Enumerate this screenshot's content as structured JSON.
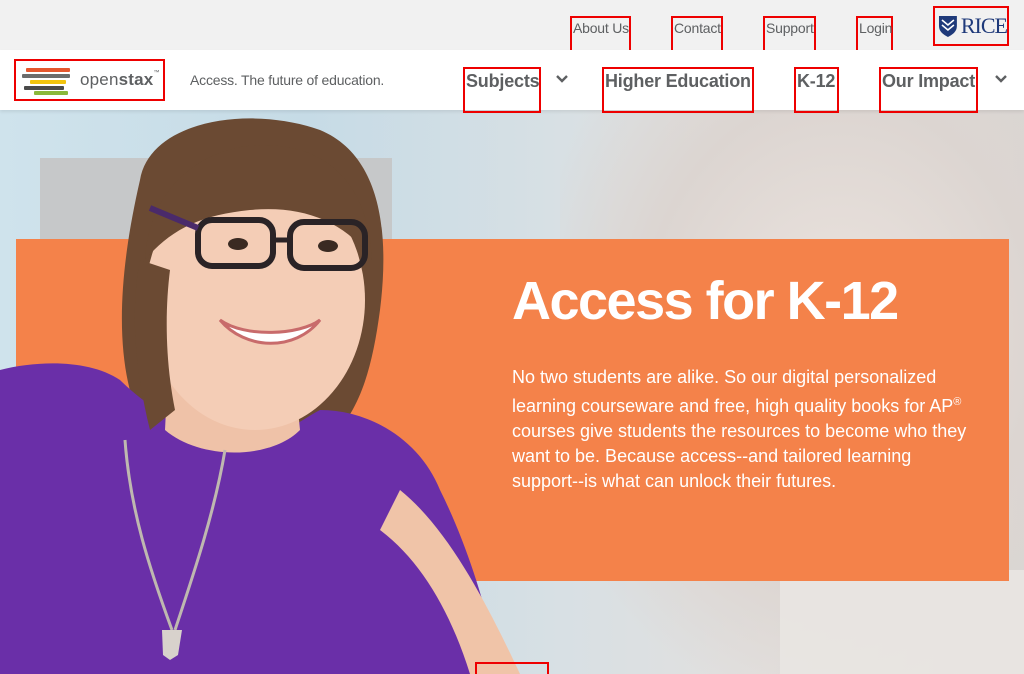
{
  "utility_nav": {
    "about": "About Us",
    "contact": "Contact",
    "support": "Support",
    "login": "Login",
    "rice_logo_text": "RICE"
  },
  "main_nav": {
    "logo_text_light": "open",
    "logo_text_bold": "stax",
    "logo_tm": "™",
    "tagline": "Access. The future of education.",
    "items": [
      {
        "label": "Subjects",
        "has_dropdown": true
      },
      {
        "label": "Higher Education",
        "has_dropdown": false
      },
      {
        "label": "K-12",
        "has_dropdown": false
      },
      {
        "label": "Our Impact",
        "has_dropdown": true
      }
    ]
  },
  "hero": {
    "title": "Access for K-12",
    "body_pre": "No two students are alike. So our digital personalized learning courseware and free, high quality books for AP",
    "body_sup": "®",
    "body_post": " courses give students the resources to become who they want to be. Because access--and tailored learning support--is what can unlock their futures."
  },
  "colors": {
    "accent_orange": "#f4824a",
    "nav_text": "#5e6062",
    "rice_blue": "#1f3a7a",
    "highlight_box": "#e00000"
  },
  "icons": [
    "rice-shield-icon",
    "chevron-down-icon"
  ]
}
